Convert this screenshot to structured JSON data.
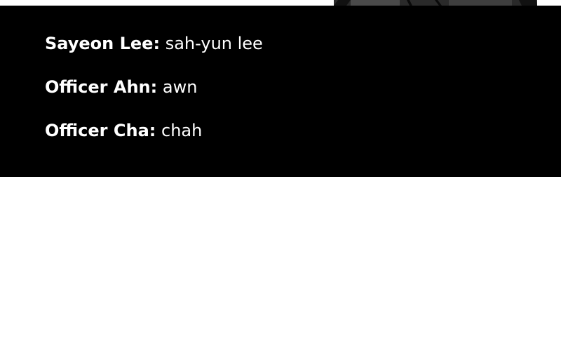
{
  "glossary": {
    "entries": [
      {
        "name": "Sayeon Lee",
        "pronunciation": "sah-yun lee"
      },
      {
        "name": "Officer Ahn",
        "pronunciation": "awn"
      },
      {
        "name": "Officer Cha",
        "pronunciation": "chah"
      }
    ],
    "separator": ":"
  },
  "colors": {
    "panel_background": "#000000",
    "text": "#ffffff",
    "page_background": "#ffffff"
  }
}
